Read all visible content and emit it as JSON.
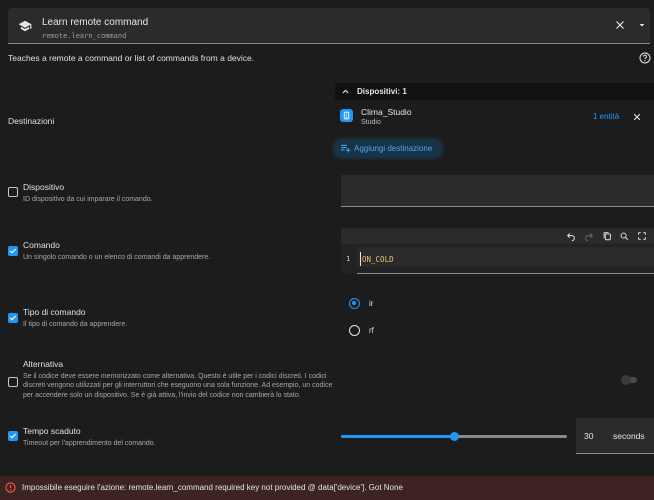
{
  "service": {
    "title": "Learn remote command",
    "id": "remote.learn_command"
  },
  "description": "Teaches a remote a command or list of commands from a device.",
  "target": {
    "label": "Destinazioni",
    "header": "Dispositivi: 1",
    "device_name": "Clima_Studio",
    "device_area": "Studio",
    "entity_count": "1 entità",
    "add_label": "Aggiungi destinazione"
  },
  "fields": {
    "device": {
      "title": "Dispositivo",
      "description": "ID dispositivo da cui imparare il comando.",
      "enabled": false
    },
    "command": {
      "title": "Comando",
      "description": "Un singolo comando o un elenco di comandi da apprendere.",
      "enabled": true,
      "line_number": "1",
      "code": "ON_COLD"
    },
    "command_type": {
      "title": "Tipo di comando",
      "description": "Il tipo di comando da apprendere.",
      "enabled": true,
      "options": [
        "ir",
        "rf"
      ],
      "selected": "ir"
    },
    "alternative": {
      "title": "Alternativa",
      "description": "Se il codice deve essere memorizzato come alternativa. Questo è utile per i codici discreti. I codici discreti vengono utilizzati per gli interruttori che eseguono una sola funzione. Ad esempio, un codice per accendere solo un dispositivo. Se è già attiva, l'invio del codice non cambierà lo stato.",
      "enabled": false,
      "toggle_on": false
    },
    "timeout": {
      "title": "Tempo scaduto",
      "description": "Timeout per l'apprendimento del comando.",
      "enabled": true,
      "value": "30",
      "unit": "seconds",
      "slider_fraction": 0.5
    }
  },
  "error": "Impossibile eseguire l'azione: remote.learn_command required key not provided @ data['device']. Got None",
  "colors": {
    "accent": "#2196f3",
    "background": "#1c1c1c",
    "error_bg": "#3e2323",
    "error_icon": "#ff5252"
  }
}
